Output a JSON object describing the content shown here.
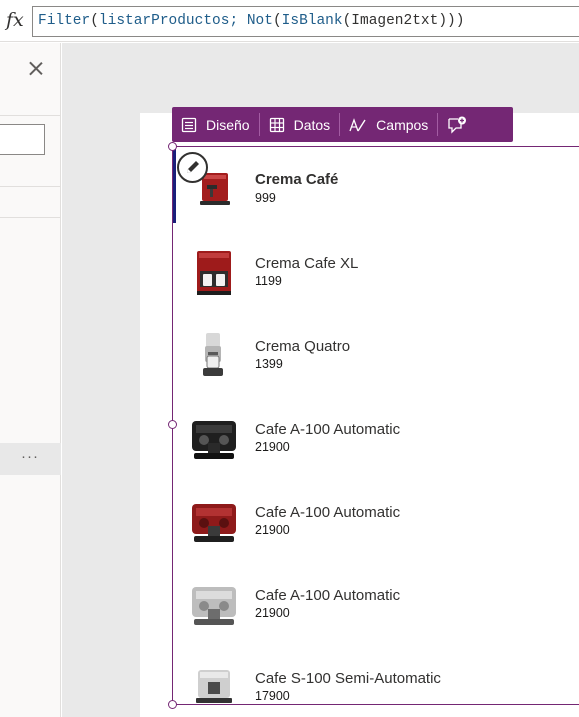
{
  "formula_bar": {
    "fx_label": "fx",
    "formula": {
      "t1": "Filter",
      "t2": "(",
      "t3": "listarProductos; ",
      "t4": "Not",
      "t5": "(",
      "t6": "IsBlank",
      "t7": "(",
      "t8": "Imagen2txt",
      "t9": ")))"
    }
  },
  "left_pane": {
    "more_label": "···"
  },
  "toolbar": {
    "layout_label": "Diseño",
    "data_label": "Datos",
    "fields_label": "Campos"
  },
  "gallery": {
    "items": [
      {
        "title": "Crema Café",
        "subtitle": "999",
        "image": "red-espresso-machine"
      },
      {
        "title": "Crema Cafe XL",
        "subtitle": "1199",
        "image": "red-dual-coffee-maker"
      },
      {
        "title": "Crema Quatro",
        "subtitle": "1399",
        "image": "white-cup-coffee-machine"
      },
      {
        "title": "Cafe A-100 Automatic",
        "subtitle": "21900",
        "image": "black-espresso-machine"
      },
      {
        "title": "Cafe A-100 Automatic",
        "subtitle": "21900",
        "image": "red-espresso-machine"
      },
      {
        "title": "Cafe A-100 Automatic",
        "subtitle": "21900",
        "image": "silver-espresso-machine"
      },
      {
        "title": "Cafe S-100 Semi-Automatic",
        "subtitle": "17900",
        "image": "white-espresso-machine"
      }
    ]
  },
  "colors": {
    "accent": "#742774",
    "selection": "#1a1f7a"
  }
}
